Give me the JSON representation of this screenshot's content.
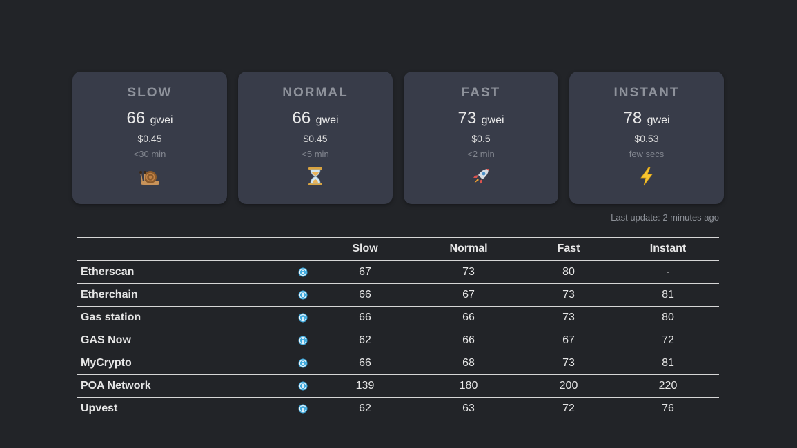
{
  "cards": [
    {
      "title": "SLOW",
      "price": "66",
      "unit": "gwei",
      "usd": "$0.45",
      "time": "<30 min",
      "icon": "snail-icon"
    },
    {
      "title": "NORMAL",
      "price": "66",
      "unit": "gwei",
      "usd": "$0.45",
      "time": "<5 min",
      "icon": "hourglass-icon"
    },
    {
      "title": "FAST",
      "price": "73",
      "unit": "gwei",
      "usd": "$0.5",
      "time": "<2 min",
      "icon": "rocket-icon"
    },
    {
      "title": "INSTANT",
      "price": "78",
      "unit": "gwei",
      "usd": "$0.53",
      "time": "few secs",
      "icon": "lightning-icon"
    }
  ],
  "last_update": "Last update: 2 minutes ago",
  "table": {
    "headers": [
      "",
      "",
      "Slow",
      "Normal",
      "Fast",
      "Instant"
    ],
    "info_icon": "info-icon",
    "rows": [
      {
        "name": "Etherscan",
        "slow": "67",
        "normal": "73",
        "fast": "80",
        "instant": "-"
      },
      {
        "name": "Etherchain",
        "slow": "66",
        "normal": "67",
        "fast": "73",
        "instant": "81"
      },
      {
        "name": "Gas station",
        "slow": "66",
        "normal": "66",
        "fast": "73",
        "instant": "80"
      },
      {
        "name": "GAS Now",
        "slow": "62",
        "normal": "66",
        "fast": "67",
        "instant": "72"
      },
      {
        "name": "MyCrypto",
        "slow": "66",
        "normal": "68",
        "fast": "73",
        "instant": "81"
      },
      {
        "name": "POA Network",
        "slow": "139",
        "normal": "180",
        "fast": "200",
        "instant": "220"
      },
      {
        "name": "Upvest",
        "slow": "62",
        "normal": "63",
        "fast": "72",
        "instant": "76"
      }
    ]
  },
  "colors": {
    "background": "#222428",
    "card": "#383c49",
    "info": "#3fa9dd"
  }
}
